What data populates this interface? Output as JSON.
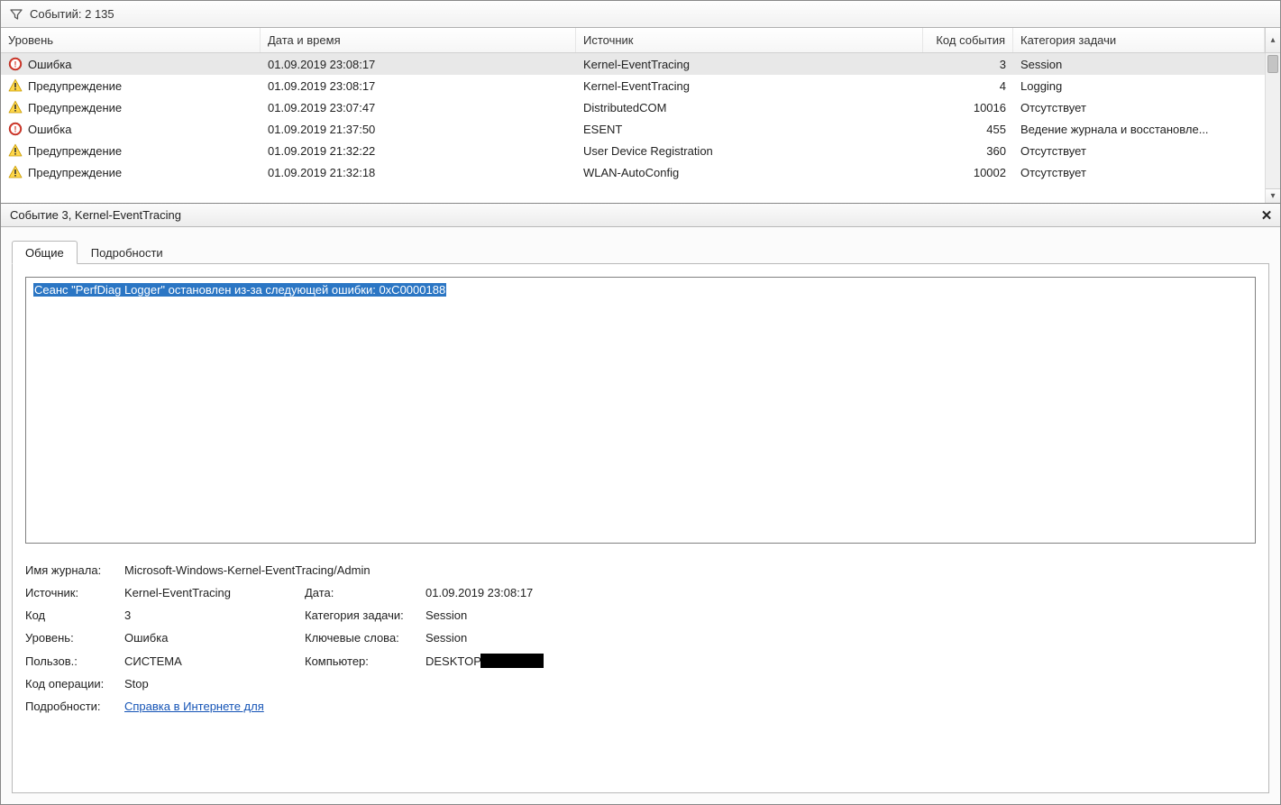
{
  "filter": {
    "label": "Событий: 2 135"
  },
  "columns": {
    "level": "Уровень",
    "date": "Дата и время",
    "source": "Источник",
    "code": "Код события",
    "task": "Категория задачи"
  },
  "rows": [
    {
      "icon": "error",
      "level": "Ошибка",
      "date": "01.09.2019 23:08:17",
      "source": "Kernel-EventTracing",
      "code": "3",
      "task": "Session",
      "selected": true
    },
    {
      "icon": "warning",
      "level": "Предупреждение",
      "date": "01.09.2019 23:08:17",
      "source": "Kernel-EventTracing",
      "code": "4",
      "task": "Logging"
    },
    {
      "icon": "warning",
      "level": "Предупреждение",
      "date": "01.09.2019 23:07:47",
      "source": "DistributedCOM",
      "code": "10016",
      "task": "Отсутствует"
    },
    {
      "icon": "error",
      "level": "Ошибка",
      "date": "01.09.2019 21:37:50",
      "source": "ESENT",
      "code": "455",
      "task": "Ведение журнала и восстановле..."
    },
    {
      "icon": "warning",
      "level": "Предупреждение",
      "date": "01.09.2019 21:32:22",
      "source": "User Device Registration",
      "code": "360",
      "task": "Отсутствует"
    },
    {
      "icon": "warning",
      "level": "Предупреждение",
      "date": "01.09.2019 21:32:18",
      "source": "WLAN-AutoConfig",
      "code": "10002",
      "task": "Отсутствует"
    }
  ],
  "detail_header": "Событие 3, Kernel-EventTracing",
  "tabs": {
    "general": "Общие",
    "details": "Подробности"
  },
  "description": "Сеанс \"PerfDiag Logger\" остановлен из-за следующей ошибки: 0xC0000188",
  "props": {
    "log_name_label": "Имя журнала:",
    "log_name": "Microsoft-Windows-Kernel-EventTracing/Admin",
    "source_label": "Источник:",
    "source": "Kernel-EventTracing",
    "date_label": "Дата:",
    "date": "01.09.2019 23:08:17",
    "code_label": "Код",
    "code": "3",
    "task_label": "Категория задачи:",
    "task": "Session",
    "level_label": "Уровень:",
    "level": "Ошибка",
    "keywords_label": "Ключевые слова:",
    "keywords": "Session",
    "user_label": "Пользов.:",
    "user": "СИСТЕМА",
    "computer_label": "Компьютер:",
    "computer": "DESKTOP",
    "opcode_label": "Код операции:",
    "opcode": "Stop",
    "more_label": "Подробности:",
    "help_link": "Справка в Интернете для "
  }
}
